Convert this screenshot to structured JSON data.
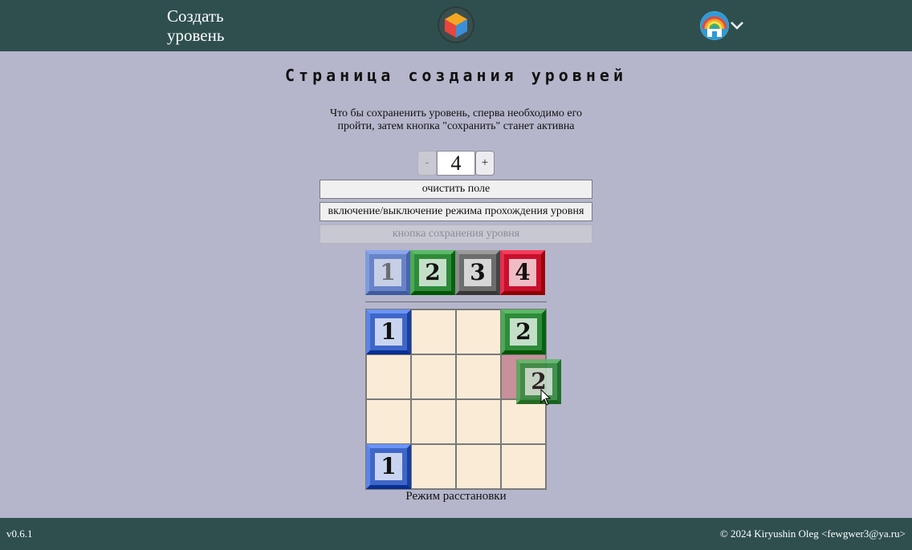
{
  "header": {
    "title": "Создать уровень",
    "logo_icon": "cube-logo-icon",
    "avatar_icon": "rainbow-avatar-icon",
    "menu_icon": "chevron-down-icon"
  },
  "main": {
    "title": "Страница создания уровней",
    "hint": "Что бы сохраненить уровень, сперва необходимо его пройти, затем кнопка \"сохранить\" станет активна",
    "stepper": {
      "minus": "-",
      "value": "4",
      "plus": "+"
    },
    "clear_button": "очистить поле",
    "toggle_play_button": "включение/выключение режима прохождения уровня",
    "save_button": "кнопка сохранения уровня",
    "save_enabled": false,
    "palette": [
      {
        "label": "1",
        "color": "#4f73c6",
        "faded": true
      },
      {
        "label": "2",
        "color": "#2e8b3a",
        "faded": false
      },
      {
        "label": "3",
        "color": "#6d6d6d",
        "faded": false
      },
      {
        "label": "4",
        "color": "#c8102e",
        "faded": false
      }
    ],
    "board": {
      "size": 4,
      "tiles": [
        {
          "row": 0,
          "col": 0,
          "label": "1",
          "color": "#3f66c9"
        },
        {
          "row": 0,
          "col": 3,
          "label": "2",
          "color": "#2e8b3a"
        },
        {
          "row": 3,
          "col": 0,
          "label": "1",
          "color": "#3f66c9"
        }
      ],
      "highlighted_cell": {
        "row": 1,
        "col": 3
      },
      "dragging_tile": {
        "label": "2",
        "color": "#2e8b3a"
      }
    },
    "mode_label": "Режим расстановки"
  },
  "footer": {
    "version": "v0.6.1",
    "copyright": "© 2024 Kiryushin Oleg <fewgwer3@ya.ru>"
  }
}
